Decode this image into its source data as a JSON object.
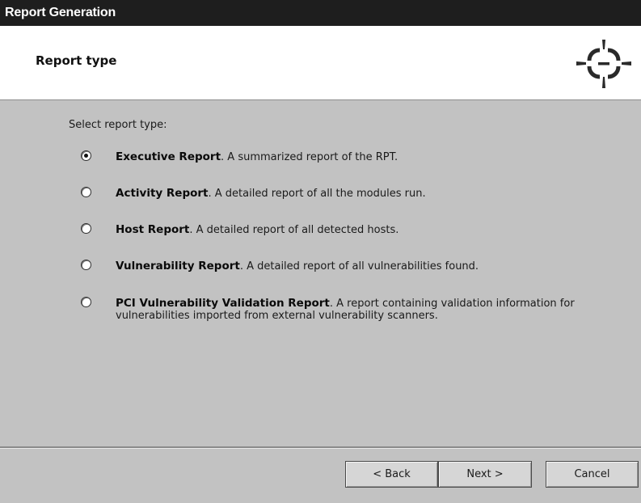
{
  "window": {
    "title": "Report Generation"
  },
  "header": {
    "title": "Report type",
    "logo_icon": "crosshair-logo-icon"
  },
  "content": {
    "prompt": "Select report type:",
    "options": [
      {
        "name": "Executive Report",
        "description": ". A summarized report of the RPT.",
        "selected": true
      },
      {
        "name": "Activity Report",
        "description": ". A detailed report of all the modules run.",
        "selected": false
      },
      {
        "name": "Host Report",
        "description": ". A detailed report of all detected hosts.",
        "selected": false
      },
      {
        "name": "Vulnerability Report",
        "description": ". A detailed report of all vulnerabilities found.",
        "selected": false
      },
      {
        "name": "PCI Vulnerability Validation Report",
        "description": ". A report containing validation information for vulnerabilities imported from external vulnerability scanners.",
        "selected": false
      }
    ]
  },
  "buttons": {
    "back": "< Back",
    "next": "Next >",
    "cancel": "Cancel"
  },
  "colors": {
    "titlebar": "#1e1e1e",
    "panel": "#c2c2c2",
    "header": "#ffffff"
  }
}
